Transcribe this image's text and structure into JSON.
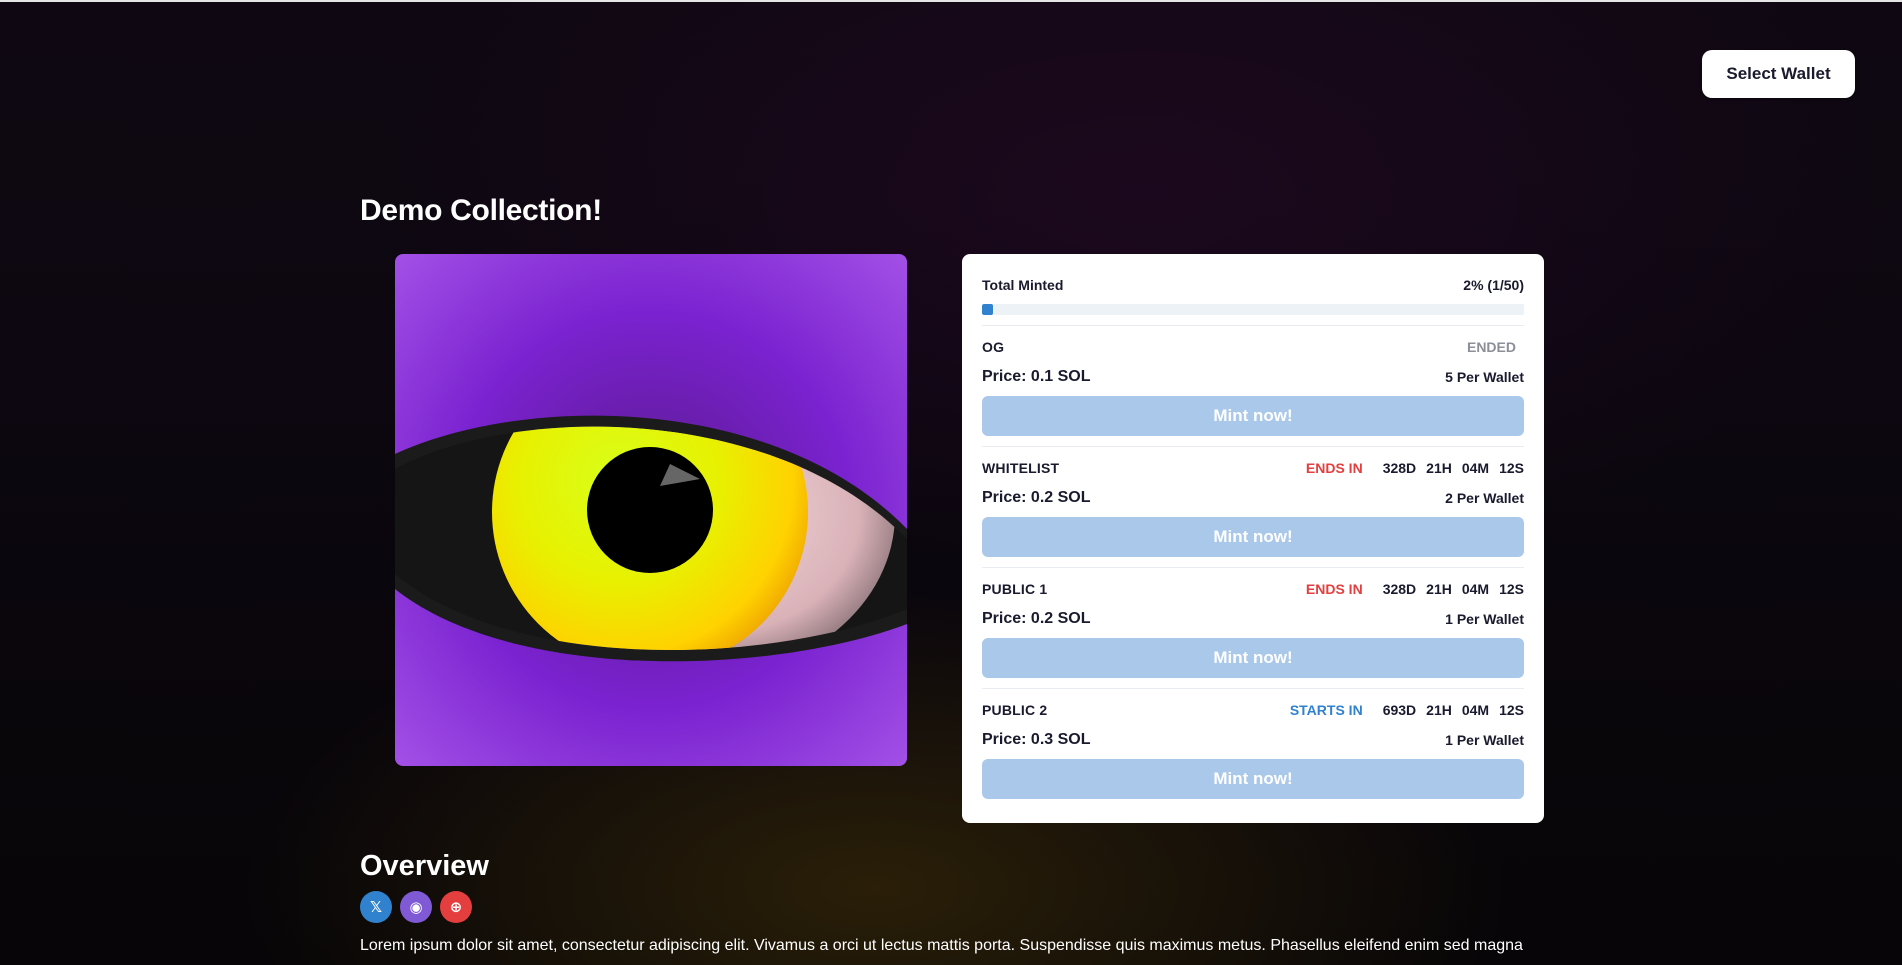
{
  "header": {
    "wallet_button": "Select Wallet"
  },
  "collection": {
    "title": "Demo Collection!",
    "image_alt": "eye-artwork"
  },
  "mint_panel": {
    "total_minted_label": "Total Minted",
    "total_minted_value": "2% (1/50)",
    "progress_fraction": 0.02,
    "phases": [
      {
        "name": "OG",
        "status_label": "ENDED",
        "status_kind": "ended",
        "timer": [],
        "price": "Price: 0.1 SOL",
        "per_wallet": "5 Per Wallet",
        "button": "Mint now!"
      },
      {
        "name": "WHITELIST",
        "status_label": "ENDS IN",
        "status_kind": "ends",
        "timer": [
          "328D",
          "21H",
          "04M",
          "12S"
        ],
        "price": "Price: 0.2 SOL",
        "per_wallet": "2 Per Wallet",
        "button": "Mint now!"
      },
      {
        "name": "PUBLIC 1",
        "status_label": "ENDS IN",
        "status_kind": "ends",
        "timer": [
          "328D",
          "21H",
          "04M",
          "12S"
        ],
        "price": "Price: 0.2 SOL",
        "per_wallet": "1 Per Wallet",
        "button": "Mint now!"
      },
      {
        "name": "PUBLIC 2",
        "status_label": "STARTS IN",
        "status_kind": "starts",
        "timer": [
          "693D",
          "21H",
          "04M",
          "12S"
        ],
        "price": "Price: 0.3 SOL",
        "per_wallet": "1 Per Wallet",
        "button": "Mint now!"
      }
    ]
  },
  "overview": {
    "heading": "Overview",
    "socials": [
      {
        "icon": "x-twitter-icon",
        "glyph": "𝕏"
      },
      {
        "icon": "discord-icon",
        "glyph": "◉"
      },
      {
        "icon": "globe-icon",
        "glyph": "⊕"
      }
    ],
    "description": "Lorem ipsum dolor sit amet, consectetur adipiscing elit. Vivamus a orci ut lectus mattis porta. Suspendisse quis maximus metus. Phasellus eleifend enim sed magna"
  },
  "colors": {
    "accent_blue": "#3182ce",
    "ends_red": "#e53e3e",
    "mint_button_disabled": "#a9c8ea",
    "art_purple": "#8a2be2"
  }
}
